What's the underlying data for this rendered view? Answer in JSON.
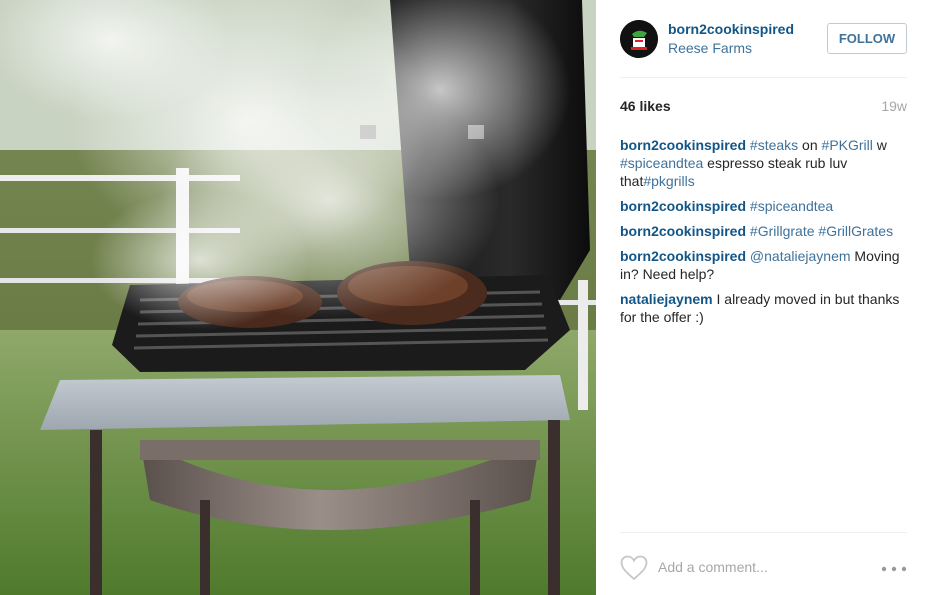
{
  "post": {
    "photo_alt": "Steaks on a smoking PK Grill outdoors"
  },
  "header": {
    "username": "born2cookinspired",
    "location": "Reese Farms",
    "follow_label": "FOLLOW"
  },
  "stats": {
    "likes": "46 likes",
    "age": "19w"
  },
  "comments": [
    {
      "user": "born2cookinspired",
      "parts": [
        {
          "t": "#steaks",
          "tag": true
        },
        {
          "t": " on ",
          "tag": false
        },
        {
          "t": "#PKGrill",
          "tag": true
        },
        {
          "t": " w ",
          "tag": false
        },
        {
          "t": "#spiceandtea",
          "tag": true
        },
        {
          "t": " espresso steak rub luv that",
          "tag": false
        },
        {
          "t": "#pkgrills",
          "tag": true
        }
      ]
    },
    {
      "user": "born2cookinspired",
      "parts": [
        {
          "t": "#spiceandtea",
          "tag": true
        }
      ]
    },
    {
      "user": "born2cookinspired",
      "parts": [
        {
          "t": "#Grillgrate",
          "tag": true
        },
        {
          "t": " ",
          "tag": false
        },
        {
          "t": "#GrillGrates",
          "tag": true
        }
      ]
    },
    {
      "user": "born2cookinspired",
      "parts": [
        {
          "t": "@nataliejaynem",
          "tag": true
        },
        {
          "t": " Moving in? Need help?",
          "tag": false
        }
      ]
    },
    {
      "user": "nataliejaynem",
      "parts": [
        {
          "t": "I already moved in but thanks for the offer :)",
          "tag": false
        }
      ]
    }
  ],
  "footer": {
    "comment_placeholder": "Add a comment...",
    "like_icon": "heart-outline-icon",
    "more_icon": "more-options-icon"
  },
  "colors": {
    "username": "#125688",
    "link": "#3f729b",
    "muted": "#a5a7aa",
    "divider": "#efefef"
  }
}
